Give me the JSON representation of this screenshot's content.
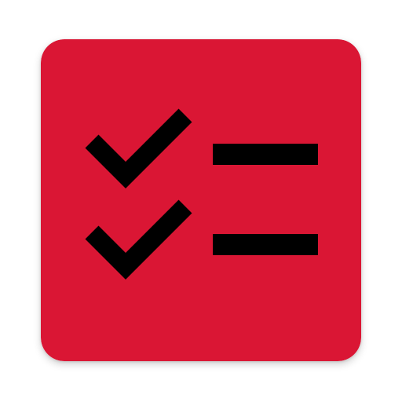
{
  "app_icon": {
    "icon_name": "checklist-icon",
    "background_color": "#DA1634",
    "glyph_color": "#000000",
    "rows": [
      {
        "icon_name": "checkmark-icon",
        "checked": true
      },
      {
        "icon_name": "checkmark-icon",
        "checked": true
      }
    ]
  }
}
